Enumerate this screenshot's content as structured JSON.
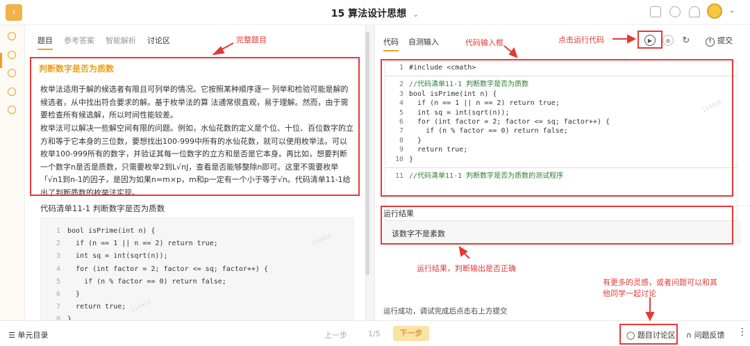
{
  "header": {
    "title_num": "15",
    "title": "算法设计思想",
    "back_icon": "chevron-left-icon"
  },
  "left": {
    "tabs": [
      "题目",
      "参考答案",
      "智能解析",
      "讨论区"
    ],
    "problem_title": "判断数字是否为质数",
    "p1": "枚举法适用于解的候选者有限且可列举的情况。它按照某种顺序逐一 列举和检验可能是解的候选者，从中找出符合要求的解。基于枚举法的算 法通常很直观，易于理解。然而，由于需要检查所有候选解，所以时间性能较差。",
    "p2": "枚举法可以解决一些解空间有限的问题。例如，水仙花数的定义是个位、十位、百位数字的立方和等于它本身的三位数，要想找出100-999中所有的水仙花数，就可以使用枚举法。可以枚举100-999所有的数字，并验证其每一位数字的立方和是否是它本身。再比如，想要判断一个数字n是否是质数，只需要枚举2到L√nJ，查看是否能够整除n即可。这里不需要枚举「√n1到n-1的因子，是因为如果n=m×p，m和p一定有一个小于等于√n。代码清单11-1给出了判断质数的枚举法实现。",
    "code_title": "代码清单11-1 判断数字是否为质数",
    "code": [
      {
        "n": "1",
        "t": "bool isPrime(int n) {"
      },
      {
        "n": "2",
        "t": "  if (n == 1 || n == 2) return true;"
      },
      {
        "n": "3",
        "t": "  int sq = int(sqrt(n));"
      },
      {
        "n": "4",
        "t": "  for (int factor = 2; factor <= sq; factor++) {"
      },
      {
        "n": "5",
        "t": "    if (n % factor == 0) return false;"
      },
      {
        "n": "6",
        "t": "  }"
      },
      {
        "n": "7",
        "t": "  return true;"
      },
      {
        "n": "8",
        "t": "}"
      }
    ]
  },
  "right": {
    "tabs": [
      "代码",
      "自测输入"
    ],
    "submit": "提交",
    "editor": [
      {
        "n": "1",
        "t": "#include <cmath>",
        "c": false
      },
      {
        "sep": true
      },
      {
        "n": "2",
        "t": "//代码清单11-1 判断数字是否为质数",
        "c": true
      },
      {
        "n": "3",
        "t": "bool isPrime(int n) {",
        "c": false
      },
      {
        "n": "4",
        "t": "  if (n == 1 || n == 2) return true;",
        "c": false
      },
      {
        "n": "5",
        "t": "  int sq = int(sqrt(n));",
        "c": false
      },
      {
        "n": "6",
        "t": "  for (int factor = 2; factor <= sq; factor++) {",
        "c": false
      },
      {
        "n": "7",
        "t": "    if (n % factor == 0) return false;",
        "c": false
      },
      {
        "n": "8",
        "t": "  }",
        "c": false
      },
      {
        "n": "9",
        "t": "  return true;",
        "c": false
      },
      {
        "n": "10",
        "t": "}",
        "c": false
      },
      {
        "sep": true
      },
      {
        "n": "11",
        "t": "//代码清单11-1 判断数字是否为质数的测试程序",
        "c": true
      }
    ],
    "result_head": "运行结果",
    "result_text": "该数字不是素数",
    "success": "运行成功，调试完成后点击右上方提交"
  },
  "bottom": {
    "unit": "单元目录",
    "prev": "上一步",
    "pager": "1/5",
    "next": "下一步",
    "discuss": "题目讨论区",
    "feedback": "问题反馈"
  },
  "annotations": {
    "a1": "完整题目",
    "a2": "代码输入框",
    "a3": "点击运行代码",
    "a4": "运行结果，判断输出是否正确",
    "a5": "有更多的灵感，或者问题可以和其",
    "a6": "他同学一起讨论"
  },
  "watermark": "114416"
}
